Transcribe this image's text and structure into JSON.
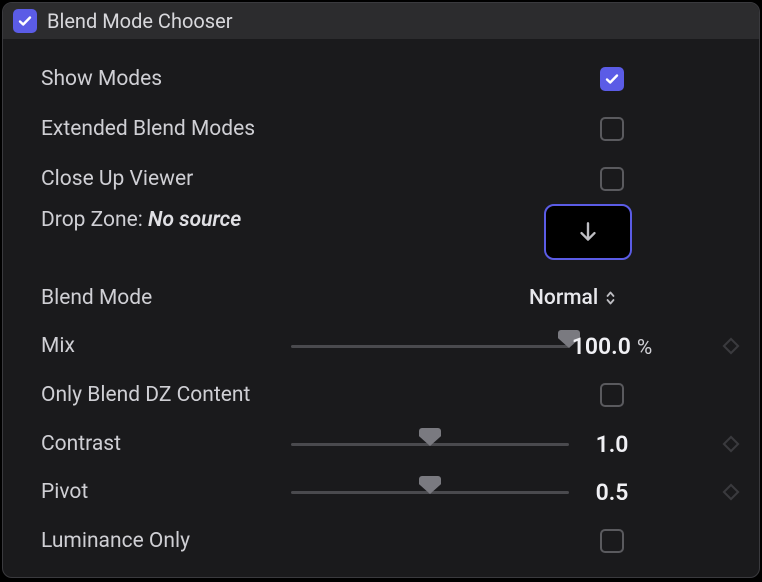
{
  "header": {
    "title": "Blend Mode Chooser",
    "enabled": true
  },
  "rows": {
    "show_modes": {
      "label": "Show Modes",
      "checked": true
    },
    "extended": {
      "label": "Extended Blend Modes",
      "checked": false
    },
    "close_up": {
      "label": "Close Up Viewer",
      "checked": false
    },
    "dropzone": {
      "label": "Drop Zone: ",
      "value": "No source"
    },
    "blend_mode": {
      "label": "Blend Mode",
      "value": "Normal"
    },
    "mix": {
      "label": "Mix",
      "value": "100.0",
      "unit": "%",
      "slider_pct": 100
    },
    "only_dz": {
      "label": "Only Blend DZ Content",
      "checked": false
    },
    "contrast": {
      "label": "Contrast",
      "value": "1.0",
      "slider_pct": 50
    },
    "pivot": {
      "label": "Pivot",
      "value": "0.5",
      "slider_pct": 50
    },
    "luminance": {
      "label": "Luminance Only",
      "checked": false
    }
  }
}
